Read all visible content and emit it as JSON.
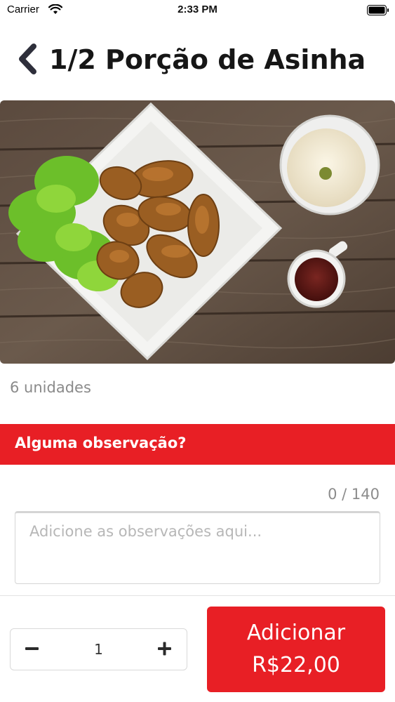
{
  "status_bar": {
    "carrier": "Carrier",
    "time": "2:33 PM"
  },
  "nav": {
    "title": "1/2 Porção de Asinha",
    "back_icon": "chevron-left-icon"
  },
  "product": {
    "image": "chicken-wings-photo",
    "description": "6 unidades"
  },
  "observations": {
    "title": "Alguma observação?",
    "counter": "0 / 140",
    "placeholder": "Adicione as observações aqui..."
  },
  "quantity": {
    "value": "1",
    "minus_icon": "minus-icon",
    "plus_icon": "plus-icon"
  },
  "add_button": {
    "label": "Adicionar",
    "price": "R$22,00"
  },
  "colors": {
    "accent": "#e81f25"
  }
}
